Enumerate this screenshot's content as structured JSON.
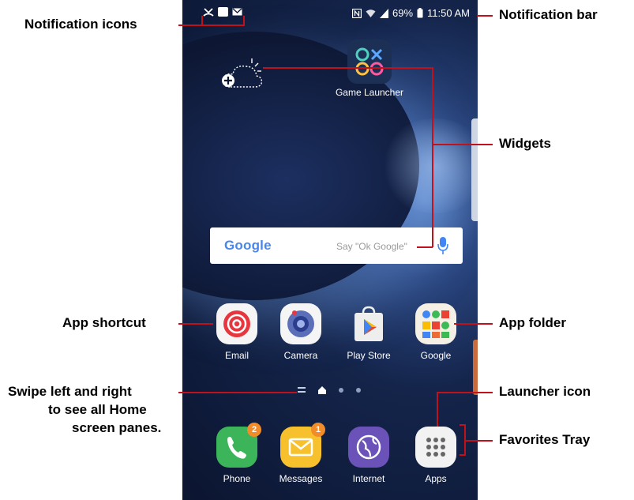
{
  "status_bar": {
    "battery": "69%",
    "time": "11:50 AM"
  },
  "widgets": {
    "game_launcher_label": "Game Launcher",
    "search": {
      "logo": "Google",
      "hint": "Say \"Ok Google\""
    }
  },
  "apps_row": [
    {
      "label": "Email",
      "icon": "email-icon"
    },
    {
      "label": "Camera",
      "icon": "camera-icon"
    },
    {
      "label": "Play Store",
      "icon": "play-store-icon"
    },
    {
      "label": "Google",
      "icon": "google-folder-icon"
    }
  ],
  "favorites": [
    {
      "label": "Phone",
      "badge": "2",
      "icon": "phone-icon"
    },
    {
      "label": "Messages",
      "badge": "1",
      "icon": "messages-icon"
    },
    {
      "label": "Internet",
      "badge": "",
      "icon": "internet-icon"
    },
    {
      "label": "Apps",
      "badge": "",
      "icon": "apps-grid-icon"
    }
  ],
  "annotations": {
    "notification_icons": "Notification icons",
    "notification_bar": "Notification bar",
    "widgets": "Widgets",
    "app_shortcut": "App shortcut",
    "app_folder": "App folder",
    "swipe_line1": "Swipe left and right",
    "swipe_line2": "to see all Home",
    "swipe_line3": "screen panes.",
    "launcher_icon": "Launcher icon",
    "favorites_tray": "Favorites Tray"
  },
  "colors": {
    "annotation_line": "#c1121c",
    "badge": "#f28c28",
    "wallpaper_dark": "#0b1530"
  }
}
